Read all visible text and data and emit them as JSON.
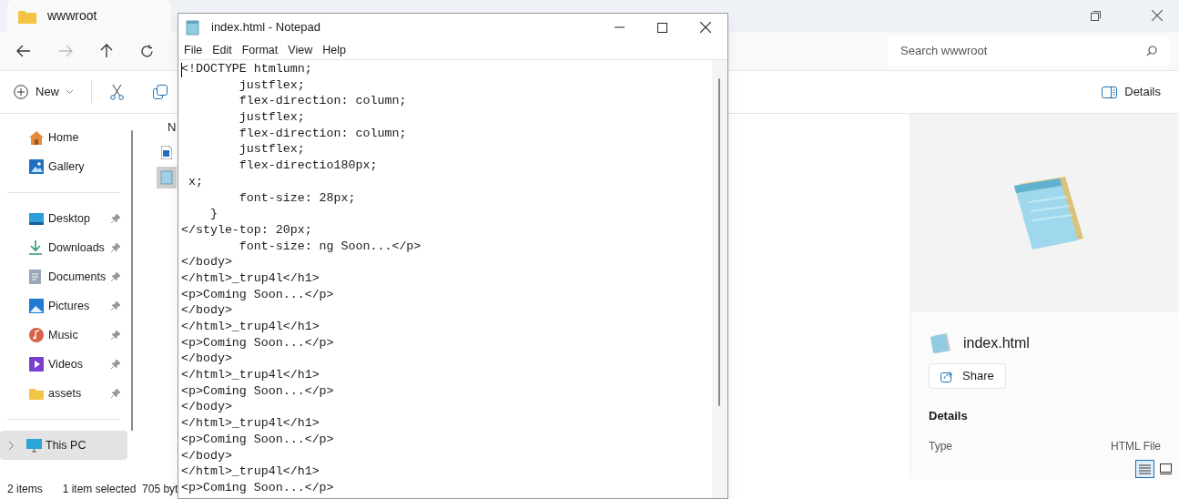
{
  "explorer": {
    "tab_title": "wwwroot",
    "search": {
      "placeholder": "Search wwwroot"
    },
    "toolbar": {
      "new_label": "New",
      "details_label": "Details"
    },
    "nav_items": [
      {
        "label": "Home",
        "kind": "home",
        "pinned": false,
        "selected": false
      },
      {
        "label": "Gallery",
        "kind": "gallery",
        "pinned": false,
        "selected": false
      },
      {
        "label": "Desktop",
        "kind": "desktop",
        "pinned": true,
        "selected": false
      },
      {
        "label": "Downloads",
        "kind": "downloads",
        "pinned": true,
        "selected": false
      },
      {
        "label": "Documents",
        "kind": "documents",
        "pinned": true,
        "selected": false
      },
      {
        "label": "Pictures",
        "kind": "pictures",
        "pinned": true,
        "selected": false
      },
      {
        "label": "Music",
        "kind": "music",
        "pinned": true,
        "selected": false
      },
      {
        "label": "Videos",
        "kind": "videos",
        "pinned": true,
        "selected": false
      },
      {
        "label": "assets",
        "kind": "folder",
        "pinned": true,
        "selected": false
      },
      {
        "label": "This PC",
        "kind": "pc",
        "pinned": false,
        "selected": true
      }
    ],
    "file_list": {
      "column_1": "N",
      "files": [
        {
          "kind": "html",
          "selected": false
        },
        {
          "kind": "notepad",
          "selected": true
        }
      ]
    },
    "status": {
      "items": "2 items",
      "selection": "1 item selected  705 byt"
    },
    "details_pane": {
      "file_name": "index.html",
      "share": "Share",
      "section": "Details",
      "properties": [
        {
          "label": "Type",
          "value": "HTML File"
        }
      ]
    },
    "view_buttons": [
      {
        "kind": "details",
        "selected": true
      },
      {
        "kind": "tiles",
        "selected": false
      }
    ]
  },
  "notepad": {
    "title": "index.html - Notepad",
    "menu": [
      "File",
      "Edit",
      "Format",
      "View",
      "Help"
    ],
    "lines": [
      "<!DOCTYPE htmlumn;",
      "        justflex;",
      "        flex-direction: column;",
      "        justflex;",
      "        flex-direction: column;",
      "        justflex;",
      "        flex-directio180px;",
      " x;",
      "        font-size: 28px;",
      "    }",
      "</style-top: 20px;",
      "        font-size: ng Soon...</p>",
      "</body>",
      "</html>_trup4l</h1>",
      "<p>Coming Soon...</p>",
      "</body>",
      "</html>_trup4l</h1>",
      "<p>Coming Soon...</p>",
      "</body>",
      "</html>_trup4l</h1>",
      "<p>Coming Soon...</p>",
      "</body>",
      "</html>_trup4l</h1>",
      "<p>Coming Soon...</p>",
      "</body>",
      "</html>_trup4l</h1>",
      "<p>Coming Soon...</p>"
    ]
  }
}
